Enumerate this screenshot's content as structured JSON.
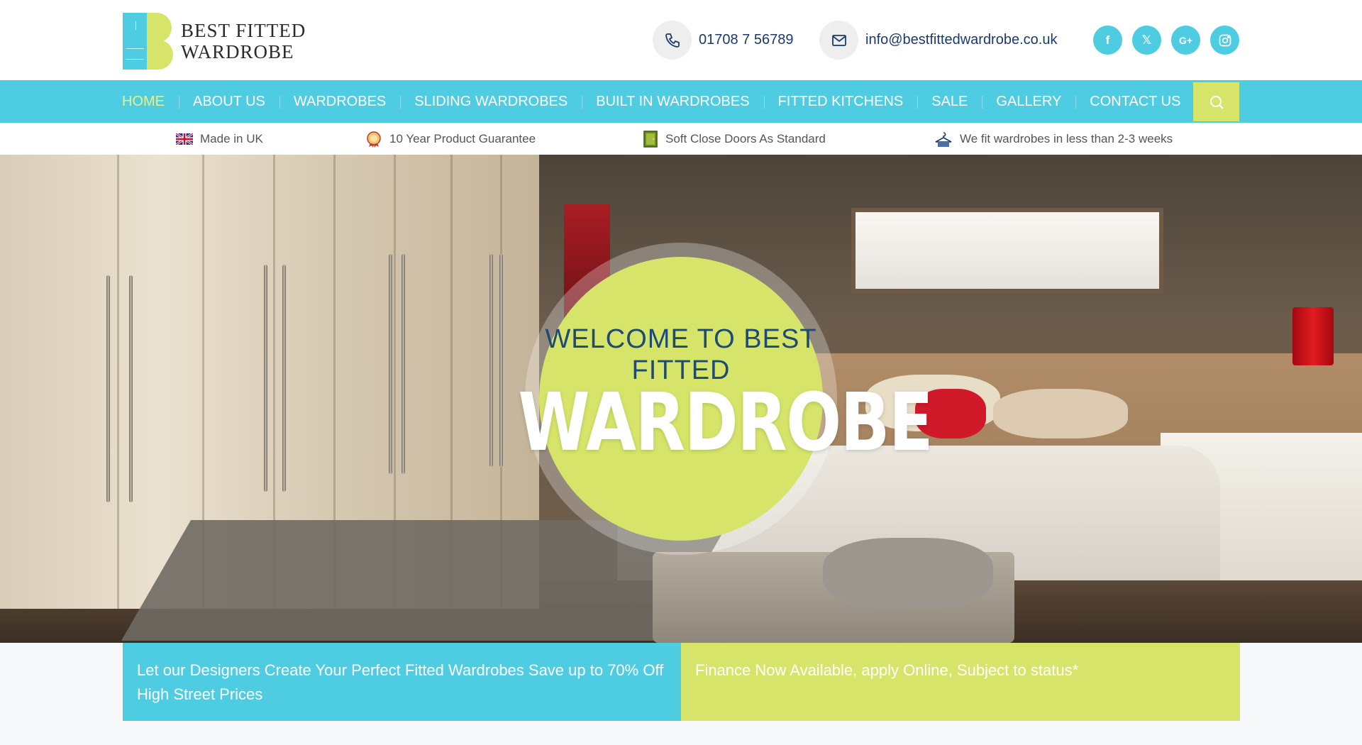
{
  "brand": {
    "line1": "BEST FITTED",
    "line2": "WARDROBE",
    "colors": {
      "teal": "#4ecde2",
      "lime": "#d6e56a",
      "navy": "#1b3a6b"
    }
  },
  "contact": {
    "phone": "01708 7 56789",
    "email": "info@bestfittedwardrobe.co.uk"
  },
  "socials": [
    {
      "icon": "facebook-icon",
      "glyph": "f"
    },
    {
      "icon": "x-twitter-icon",
      "glyph": "𝕏"
    },
    {
      "icon": "google-plus-icon",
      "glyph": "G+"
    },
    {
      "icon": "instagram-icon",
      "glyph": "◎"
    }
  ],
  "nav": {
    "items": [
      "HOME",
      "ABOUT US",
      "WARDROBES",
      "SLIDING WARDROBES",
      "BUILT IN WARDROBES",
      "FITTED KITCHENS",
      "SALE",
      "GALLERY",
      "CONTACT US"
    ],
    "active": "HOME"
  },
  "features": [
    {
      "icon": "uk-flag-icon",
      "label": "Made in UK"
    },
    {
      "icon": "award-badge-icon",
      "label": "10 Year Product Guarantee"
    },
    {
      "icon": "door-icon",
      "label": "Soft Close Doors As Standard"
    },
    {
      "icon": "hanger-icon",
      "label": "We fit wardrobes in less than 2-3 weeks"
    }
  ],
  "hero": {
    "small": "WELCOME TO BEST FITTED",
    "big": "WARDROBE"
  },
  "banners": {
    "left": "Let our Designers Create Your Perfect Fitted Wardrobes Save up to 70% Off High Street Prices",
    "right": "Finance Now Available, apply Online, Subject to status*"
  }
}
